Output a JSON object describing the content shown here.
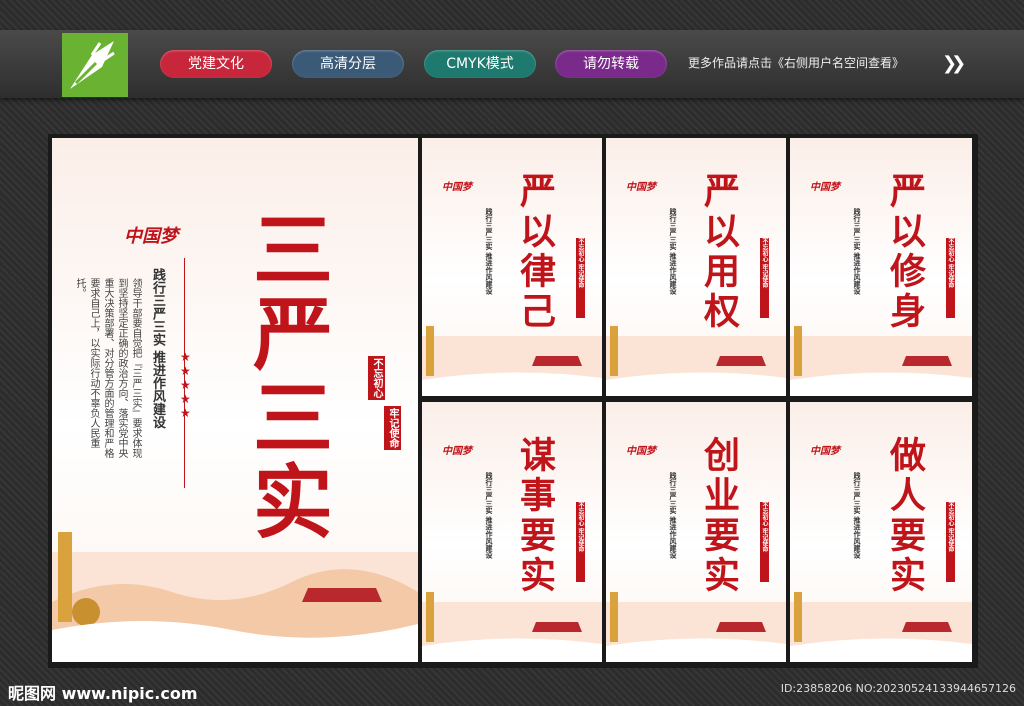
{
  "header": {
    "tags": [
      {
        "label": "党建文化",
        "color": "#c8263a"
      },
      {
        "label": "高清分层",
        "color": "#3a5a78"
      },
      {
        "label": "CMYK模式",
        "color": "#1e7a6e"
      },
      {
        "label": "请勿转载",
        "color": "#7a2a8a"
      }
    ],
    "more_text": "更多作品请点击《右侧用户名空间查看》",
    "arrow": "❯❯"
  },
  "main_poster": {
    "title": "三严三实",
    "subtitle": "践行三严三实 推进作风建设",
    "body": "领导干部要自觉把『三严三实』要求体现到坚持坚定正确的政治方向、落实党中央重大决策部署、对分管方面的管理和严格要求自己上，以实际行动不辜负人民重托。",
    "slogan_left": "不忘初心",
    "slogan_right": "牢记使命",
    "dream": "中国梦"
  },
  "panels": [
    {
      "title": "严以律己"
    },
    {
      "title": "严以用权"
    },
    {
      "title": "严以修身"
    },
    {
      "title": "谋事要实"
    },
    {
      "title": "创业要实"
    },
    {
      "title": "做人要实"
    }
  ],
  "panel_common": {
    "subtitle": "践行三严三实 推进作风建设",
    "slogan": "不忘初心 牢记使命",
    "dream": "中国梦"
  },
  "footer": {
    "site": "昵图网 www.nipic.com",
    "id": "ID:23858206 NO:20230524133944657126"
  },
  "colors": {
    "accent": "#c0141b"
  }
}
